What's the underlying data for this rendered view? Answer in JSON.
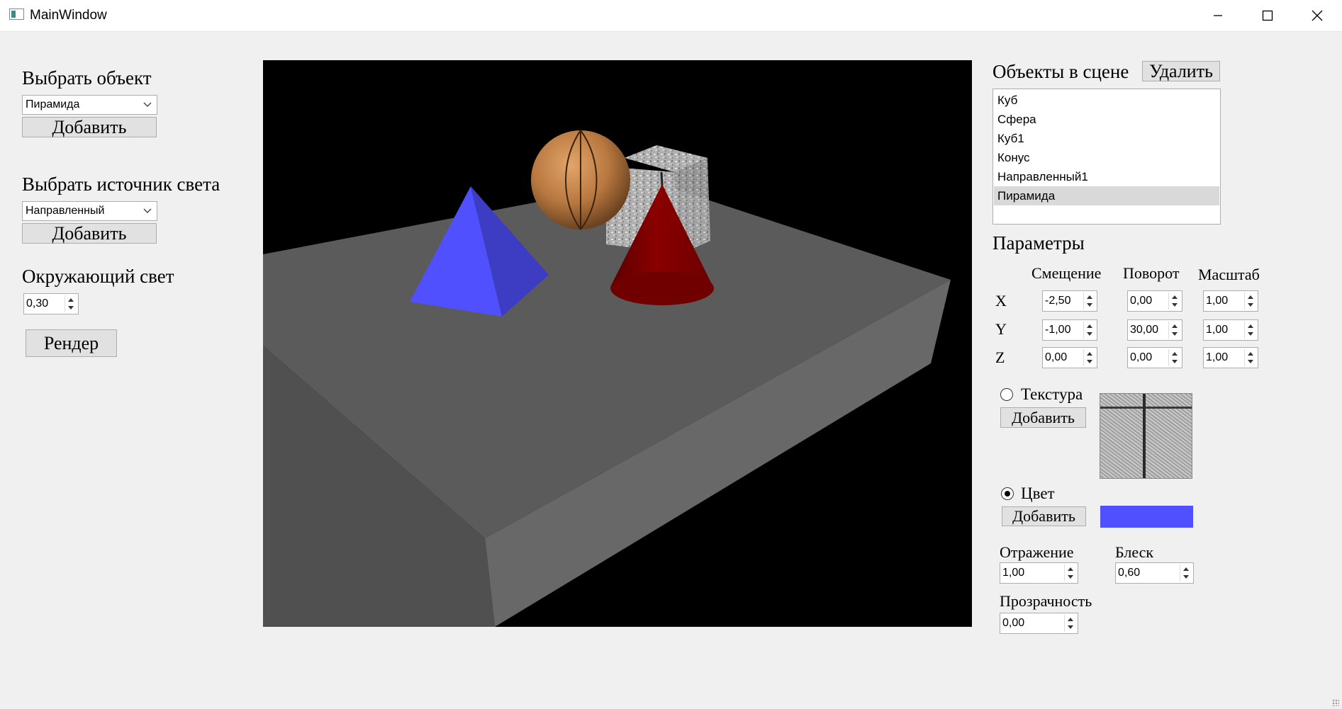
{
  "window": {
    "title": "MainWindow"
  },
  "left_panel": {
    "choose_object_label": "Выбрать объект",
    "object_combo_value": "Пирамида",
    "add_object_label": "Добавить",
    "choose_light_label": "Выбрать источник света",
    "light_combo_value": "Направленный",
    "add_light_label": "Добавить",
    "ambient_label": "Окружающий свет",
    "ambient_value": "0,30",
    "render_label": "Рендер"
  },
  "scene": {
    "header": "Объекты в сцене",
    "delete_label": "Удалить",
    "objects": [
      "Куб",
      "Сфера",
      "Куб1",
      "Конус",
      "Направленный1",
      "Пирамида"
    ],
    "selected_index": 5
  },
  "params": {
    "title": "Параметры",
    "col_offset": "Смещение",
    "col_rotation": "Поворот",
    "col_scale": "Масштаб",
    "rows": [
      {
        "axis": "X",
        "offset": "-2,50",
        "rotation": "0,00",
        "scale": "1,00"
      },
      {
        "axis": "Y",
        "offset": "-1,00",
        "rotation": "30,00",
        "scale": "1,00"
      },
      {
        "axis": "Z",
        "offset": "0,00",
        "rotation": "0,00",
        "scale": "1,00"
      }
    ]
  },
  "material": {
    "texture_label": "Текстура",
    "texture_selected": false,
    "texture_add_label": "Добавить",
    "color_label": "Цвет",
    "color_selected": true,
    "color_add_label": "Добавить",
    "color_value": "#5050ff",
    "reflection_label": "Отражение",
    "reflection_value": "1,00",
    "shine_label": "Блеск",
    "shine_value": "0,60",
    "transparency_label": "Прозрачность",
    "transparency_value": "0,00"
  }
}
